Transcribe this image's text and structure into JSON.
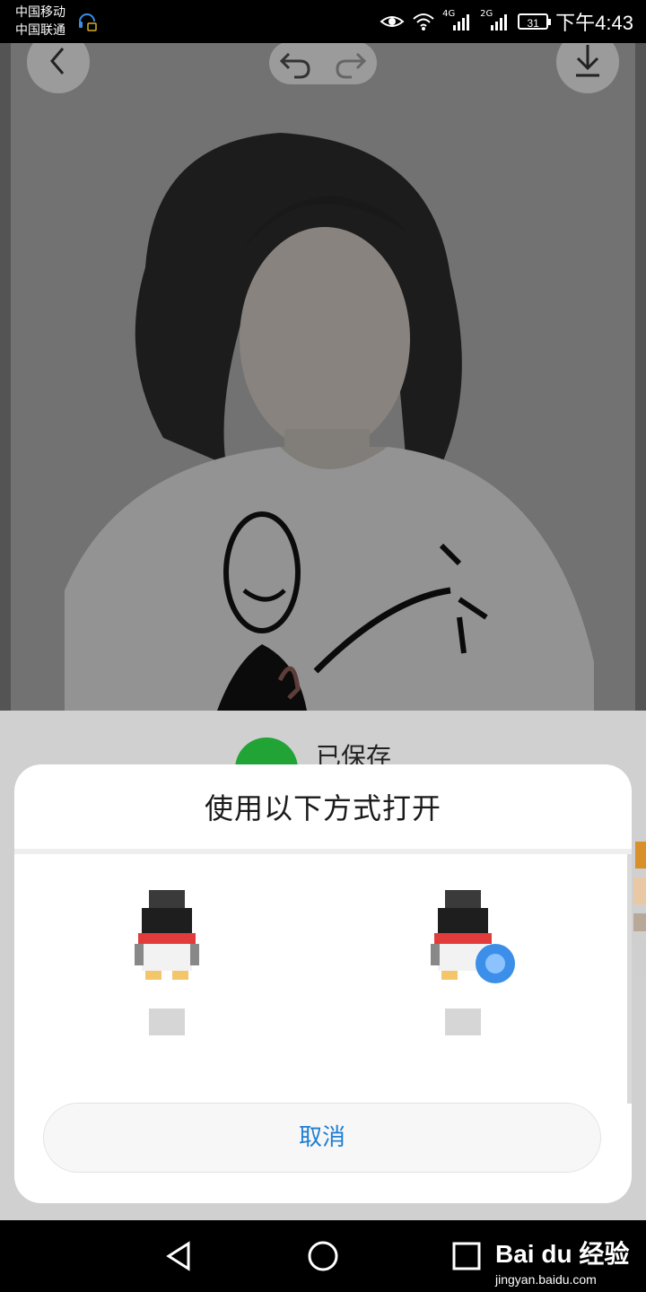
{
  "status_bar": {
    "carrier_1": "中国移动",
    "carrier_2": "中国联通",
    "net_1": "4G",
    "net_2": "2G",
    "battery": "31",
    "time": "下午4:43"
  },
  "viewer": {
    "icons": [
      "back-icon",
      "undo-icon",
      "redo-icon",
      "download-icon"
    ]
  },
  "toast": {
    "saved_text": "已保存"
  },
  "sheet": {
    "title": "使用以下方式打开",
    "apps": [
      {
        "icon": "qq-penguin-icon"
      },
      {
        "icon": "qq-penguin-browser-icon"
      }
    ],
    "cancel_label": "取消"
  },
  "nav": {
    "icons": [
      "back-triangle-icon",
      "home-circle-icon",
      "recents-square-icon"
    ]
  },
  "watermark": {
    "logo": "Bai du 经验",
    "url": "jingyan.baidu.com"
  },
  "colors": {
    "accent_blue": "#1f7fd1",
    "saved_green": "#21a336"
  }
}
